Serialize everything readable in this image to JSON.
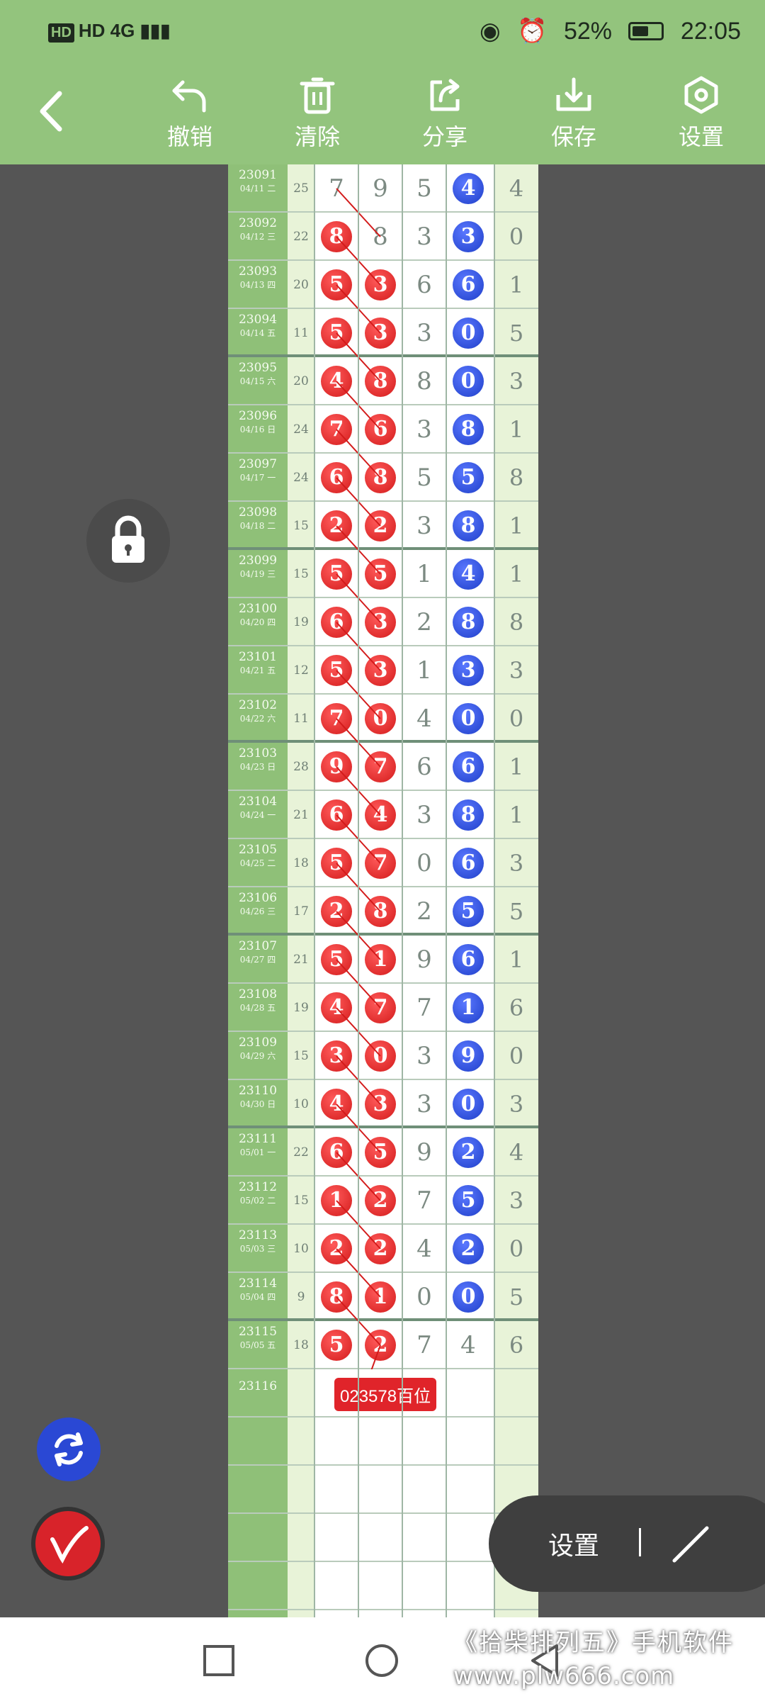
{
  "status_bar": {
    "left": "HD 4G",
    "battery": "52%",
    "time": "22:05"
  },
  "toolbar": {
    "undo": "撤销",
    "clear": "清除",
    "share": "分享",
    "save": "保存",
    "settings": "设置"
  },
  "rows": [
    {
      "issue": "23091",
      "date": "04/11 二",
      "sum": "25",
      "d": [
        "7",
        "9",
        "5",
        "4",
        "4"
      ],
      "hl": [
        0,
        0,
        0,
        2
      ]
    },
    {
      "issue": "23092",
      "date": "04/12 三",
      "sum": "22",
      "d": [
        "8",
        "8",
        "3",
        "3",
        "0"
      ],
      "hl": [
        1,
        0,
        0,
        2
      ]
    },
    {
      "issue": "23093",
      "date": "04/13 四",
      "sum": "20",
      "d": [
        "5",
        "3",
        "6",
        "6",
        "1"
      ],
      "hl": [
        1,
        1,
        0,
        2
      ]
    },
    {
      "issue": "23094",
      "date": "04/14 五",
      "sum": "11",
      "d": [
        "5",
        "3",
        "3",
        "0",
        "5"
      ],
      "hl": [
        1,
        1,
        0,
        2
      ]
    },
    {
      "issue": "23095",
      "date": "04/15 六",
      "sum": "20",
      "d": [
        "4",
        "8",
        "8",
        "0",
        "3"
      ],
      "hl": [
        1,
        1,
        0,
        2
      ]
    },
    {
      "issue": "23096",
      "date": "04/16 日",
      "sum": "24",
      "d": [
        "7",
        "6",
        "3",
        "8",
        "1"
      ],
      "hl": [
        1,
        1,
        0,
        2
      ]
    },
    {
      "issue": "23097",
      "date": "04/17 一",
      "sum": "24",
      "d": [
        "6",
        "8",
        "5",
        "5",
        "8"
      ],
      "hl": [
        1,
        1,
        0,
        2
      ]
    },
    {
      "issue": "23098",
      "date": "04/18 二",
      "sum": "15",
      "d": [
        "2",
        "2",
        "3",
        "8",
        "1"
      ],
      "hl": [
        1,
        1,
        0,
        2
      ]
    },
    {
      "issue": "23099",
      "date": "04/19 三",
      "sum": "15",
      "d": [
        "5",
        "5",
        "1",
        "4",
        "1"
      ],
      "hl": [
        1,
        1,
        0,
        2
      ]
    },
    {
      "issue": "23100",
      "date": "04/20 四",
      "sum": "19",
      "d": [
        "6",
        "3",
        "2",
        "8",
        "8"
      ],
      "hl": [
        1,
        1,
        0,
        2
      ]
    },
    {
      "issue": "23101",
      "date": "04/21 五",
      "sum": "12",
      "d": [
        "5",
        "3",
        "1",
        "3",
        "3"
      ],
      "hl": [
        1,
        1,
        0,
        2
      ]
    },
    {
      "issue": "23102",
      "date": "04/22 六",
      "sum": "11",
      "d": [
        "7",
        "0",
        "4",
        "0",
        "0"
      ],
      "hl": [
        1,
        1,
        0,
        2
      ]
    },
    {
      "issue": "23103",
      "date": "04/23 日",
      "sum": "28",
      "d": [
        "9",
        "7",
        "6",
        "6",
        "1"
      ],
      "hl": [
        1,
        1,
        0,
        2
      ]
    },
    {
      "issue": "23104",
      "date": "04/24 一",
      "sum": "21",
      "d": [
        "6",
        "4",
        "3",
        "8",
        "1"
      ],
      "hl": [
        1,
        1,
        0,
        2
      ]
    },
    {
      "issue": "23105",
      "date": "04/25 二",
      "sum": "18",
      "d": [
        "5",
        "7",
        "0",
        "6",
        "3"
      ],
      "hl": [
        1,
        1,
        0,
        2
      ]
    },
    {
      "issue": "23106",
      "date": "04/26 三",
      "sum": "17",
      "d": [
        "2",
        "8",
        "2",
        "5",
        "5"
      ],
      "hl": [
        1,
        1,
        0,
        2
      ]
    },
    {
      "issue": "23107",
      "date": "04/27 四",
      "sum": "21",
      "d": [
        "5",
        "1",
        "9",
        "6",
        "1"
      ],
      "hl": [
        1,
        1,
        0,
        2
      ]
    },
    {
      "issue": "23108",
      "date": "04/28 五",
      "sum": "19",
      "d": [
        "4",
        "7",
        "7",
        "1",
        "6"
      ],
      "hl": [
        1,
        1,
        0,
        2
      ]
    },
    {
      "issue": "23109",
      "date": "04/29 六",
      "sum": "15",
      "d": [
        "3",
        "0",
        "3",
        "9",
        "0"
      ],
      "hl": [
        1,
        1,
        0,
        2
      ]
    },
    {
      "issue": "23110",
      "date": "04/30 日",
      "sum": "10",
      "d": [
        "4",
        "3",
        "3",
        "0",
        "3"
      ],
      "hl": [
        1,
        1,
        0,
        2
      ]
    },
    {
      "issue": "23111",
      "date": "05/01 一",
      "sum": "22",
      "d": [
        "6",
        "5",
        "9",
        "2",
        "4"
      ],
      "hl": [
        1,
        1,
        0,
        2
      ]
    },
    {
      "issue": "23112",
      "date": "05/02 二",
      "sum": "15",
      "d": [
        "1",
        "2",
        "7",
        "5",
        "3"
      ],
      "hl": [
        1,
        1,
        0,
        2
      ]
    },
    {
      "issue": "23113",
      "date": "05/03 三",
      "sum": "10",
      "d": [
        "2",
        "2",
        "4",
        "2",
        "0"
      ],
      "hl": [
        1,
        1,
        0,
        2
      ]
    },
    {
      "issue": "23114",
      "date": "05/04 四",
      "sum": "9",
      "d": [
        "8",
        "1",
        "0",
        "0",
        "5"
      ],
      "hl": [
        1,
        1,
        0,
        2
      ]
    },
    {
      "issue": "23115",
      "date": "05/05 五",
      "sum": "18",
      "d": [
        "5",
        "2",
        "7",
        "4",
        "6"
      ],
      "hl": [
        1,
        1,
        0,
        0
      ]
    }
  ],
  "next_issue": "23116",
  "prediction_label": "023578百位",
  "settings_pill_label": "设置",
  "watermark": {
    "line1": "《拾柴排列五》手机软件",
    "line2": "www.plw666.com"
  },
  "colors": {
    "header_green": "#93c47d",
    "red_ball": "#d31b1b",
    "blue_ball": "#1f3fc9",
    "issue_col": "#8fc078"
  }
}
